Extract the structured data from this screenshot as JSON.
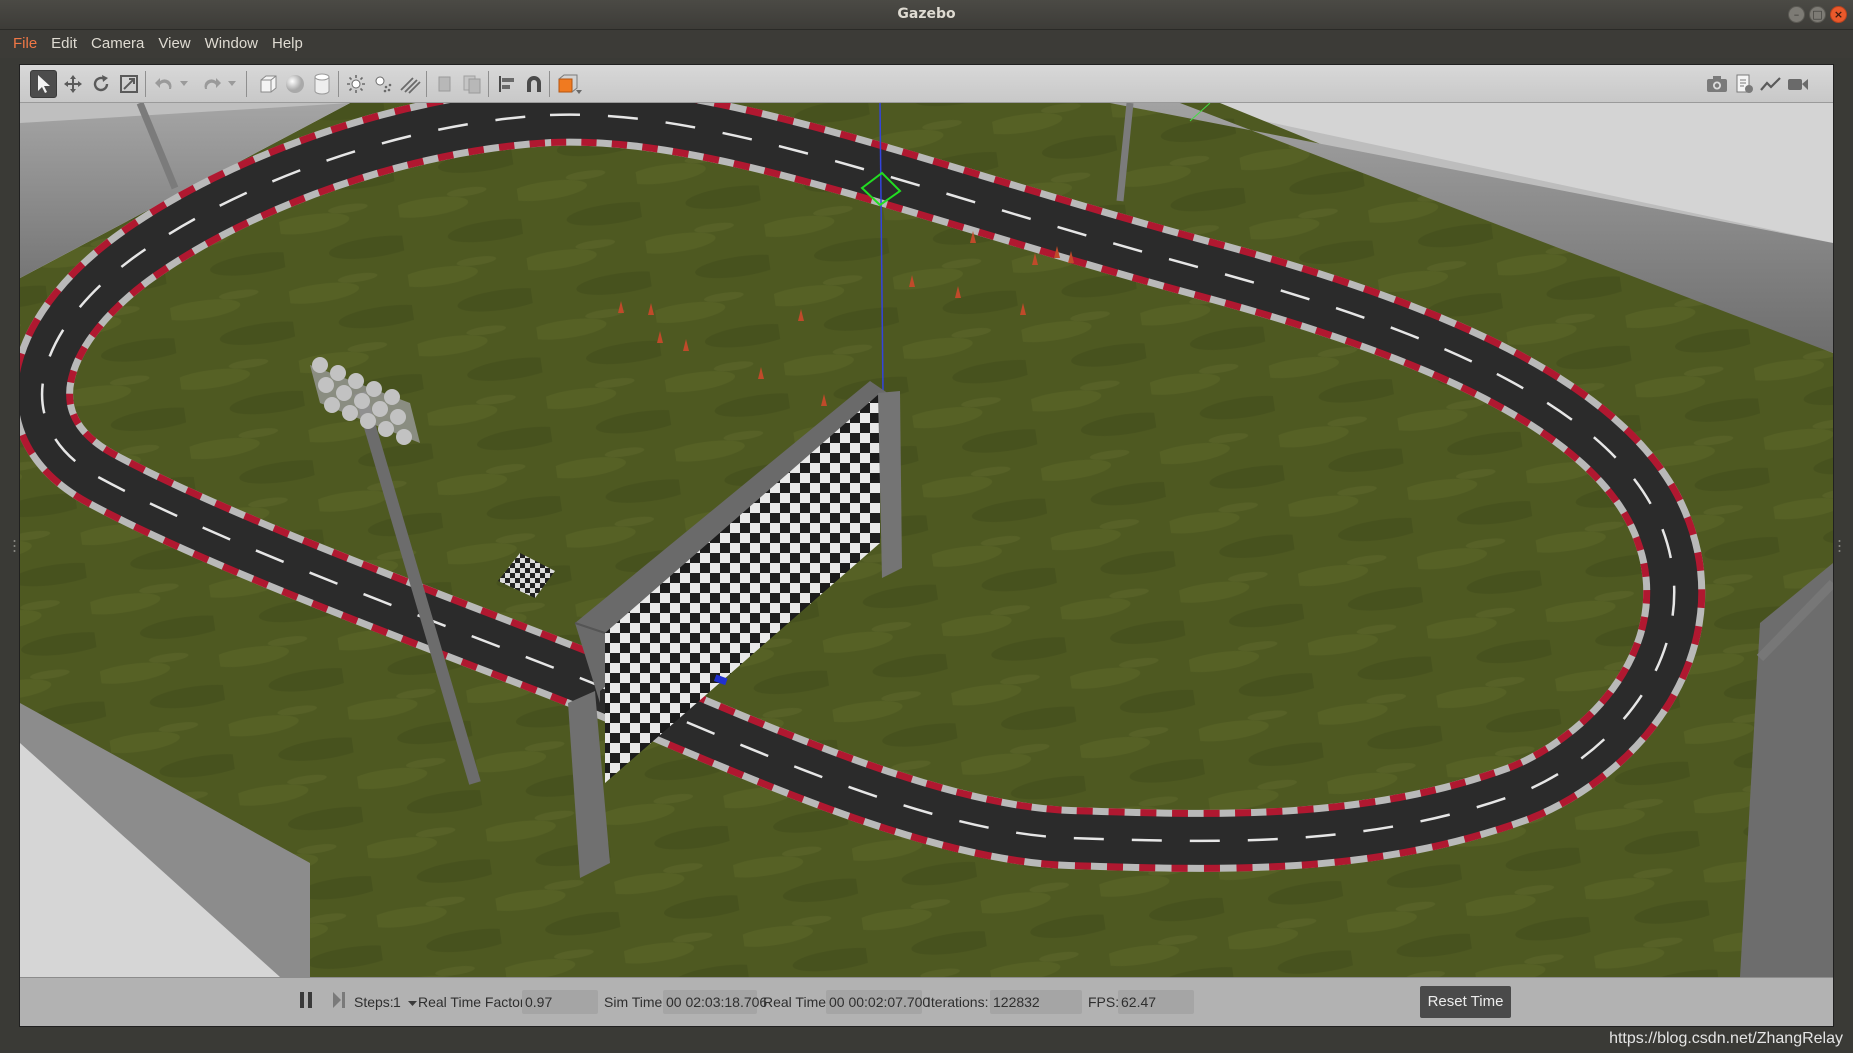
{
  "window": {
    "title": "Gazebo"
  },
  "menu": [
    "File",
    "Edit",
    "Camera",
    "View",
    "Window",
    "Help"
  ],
  "toolbar": {
    "left_tools": [
      "select-mode-icon",
      "translate-mode-icon",
      "rotate-mode-icon",
      "scale-mode-icon",
      "undo-icon",
      "undo-dropdown-icon",
      "redo-icon",
      "redo-dropdown-icon",
      "box-shape-icon",
      "sphere-shape-icon",
      "cylinder-shape-icon",
      "point-light-icon",
      "spot-light-icon",
      "directional-light-icon",
      "copy-icon",
      "paste-icon",
      "align-icon",
      "snap-icon",
      "view-angle-icon"
    ],
    "right_tools": [
      "screenshot-icon",
      "log-icon",
      "plot-icon",
      "video-record-icon"
    ]
  },
  "status": {
    "steps_label": "Steps:",
    "steps_value": "1",
    "rtf_label": "Real Time Factor:",
    "rtf_value": "0.97",
    "sim_time_label": "Sim Time:",
    "sim_time_value": "00 02:03:18.706",
    "real_time_label": "Real Time:",
    "real_time_value": "00 00:02:07.700",
    "iterations_label": "Iterations:",
    "iterations_value": "122832",
    "fps_label": "FPS:",
    "fps_value": "62.47",
    "reset_label": "Reset Time"
  },
  "watermark": "https://blog.csdn.net/ZhangRelay",
  "colors": {
    "accent": "#f07746",
    "grass": "#4f5a22",
    "track": "#2b2b2b",
    "curb_red": "#b01830"
  }
}
